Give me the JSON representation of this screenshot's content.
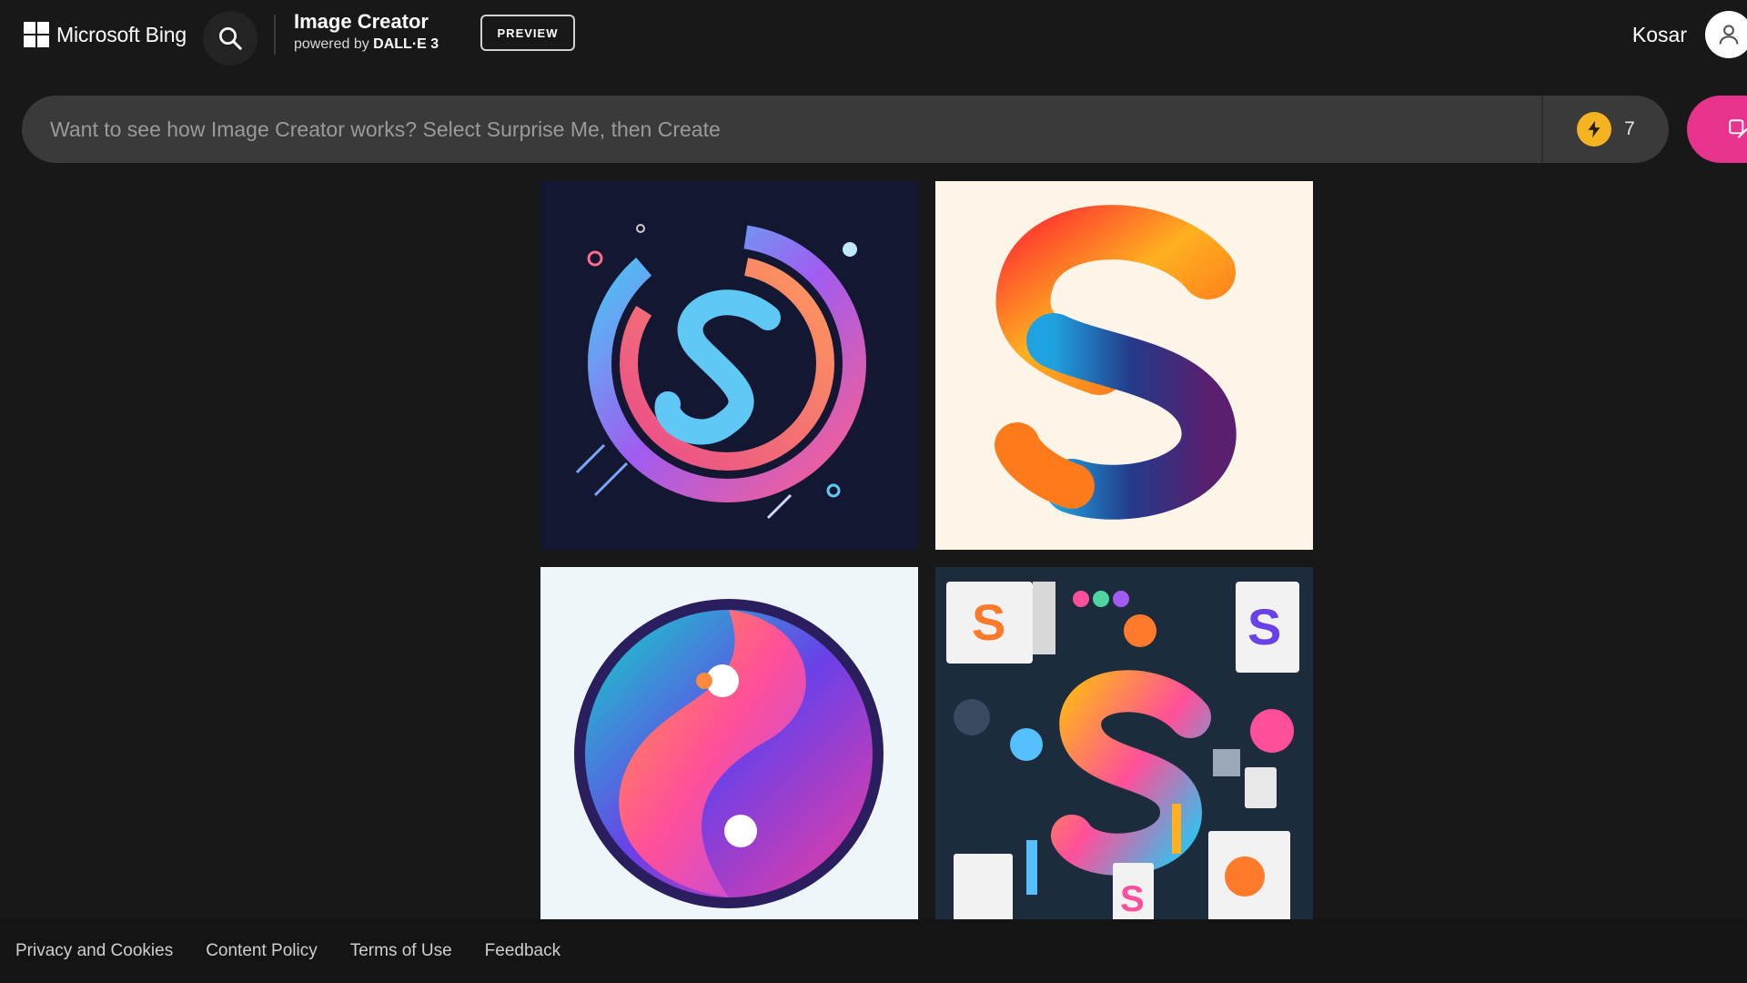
{
  "header": {
    "brand_label": "Microsoft Bing",
    "product_title": "Image Creator",
    "product_powered_prefix": "powered by",
    "product_powered_model": "DALL·E 3",
    "preview_label": "PREVIEW",
    "user_name": "Kosar"
  },
  "prompt": {
    "placeholder": "Want to see how Image Creator works? Select Surprise Me, then Create",
    "value": "",
    "boosts_count": "7"
  },
  "icons": {
    "logo": "windows-logo-icon",
    "search": "search-icon",
    "avatar": "user-avatar-icon",
    "boost": "lightning-bolt-icon",
    "create": "create-brush-icon"
  },
  "colors": {
    "background": "#181818",
    "prompt_bar": "#3a3a3a",
    "create_accent": "#e8338c",
    "boost_coin": "#f4b321",
    "footer_bg": "#141414"
  },
  "images": [
    {
      "id": "generated-image-1"
    },
    {
      "id": "generated-image-2"
    },
    {
      "id": "generated-image-3"
    },
    {
      "id": "generated-image-4"
    }
  ],
  "footer": {
    "links": [
      "Privacy and Cookies",
      "Content Policy",
      "Terms of Use",
      "Feedback"
    ]
  }
}
